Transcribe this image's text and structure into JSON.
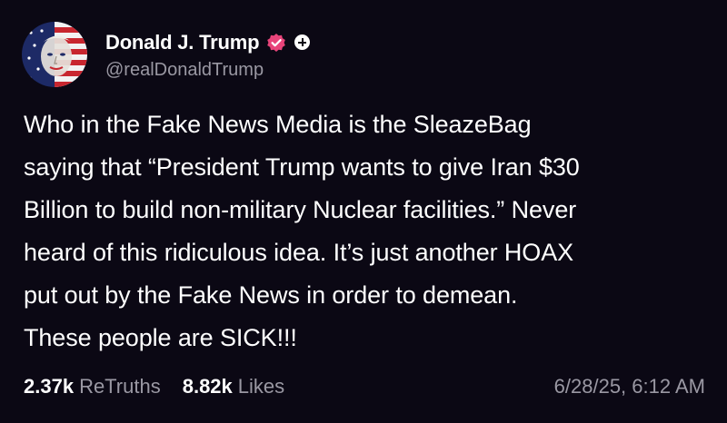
{
  "post": {
    "author": {
      "display_name": "Donald J. Trump",
      "handle": "@realDonaldTrump",
      "verified_icon": "verified-badge-icon",
      "follow_icon": "plus-icon"
    },
    "body_lines": [
      "Who in the Fake News Media is the SleazeBag",
      "saying that “President Trump wants to give Iran $30",
      "Billion to build non-military Nuclear facilities.” Never",
      "heard of this ridiculous idea. It’s just another HOAX",
      "put out by the Fake News in order to demean.",
      "These people are SICK!!!"
    ],
    "stats": {
      "retruths_count": "2.37k",
      "retruths_label": "ReTruths",
      "likes_count": "8.82k",
      "likes_label": "Likes"
    },
    "timestamp": "6/28/25, 6:12 AM"
  },
  "colors": {
    "background": "#0b0814",
    "text_primary": "#ffffff",
    "text_secondary": "#9a98a3",
    "verified_badge": "#e8447a"
  }
}
